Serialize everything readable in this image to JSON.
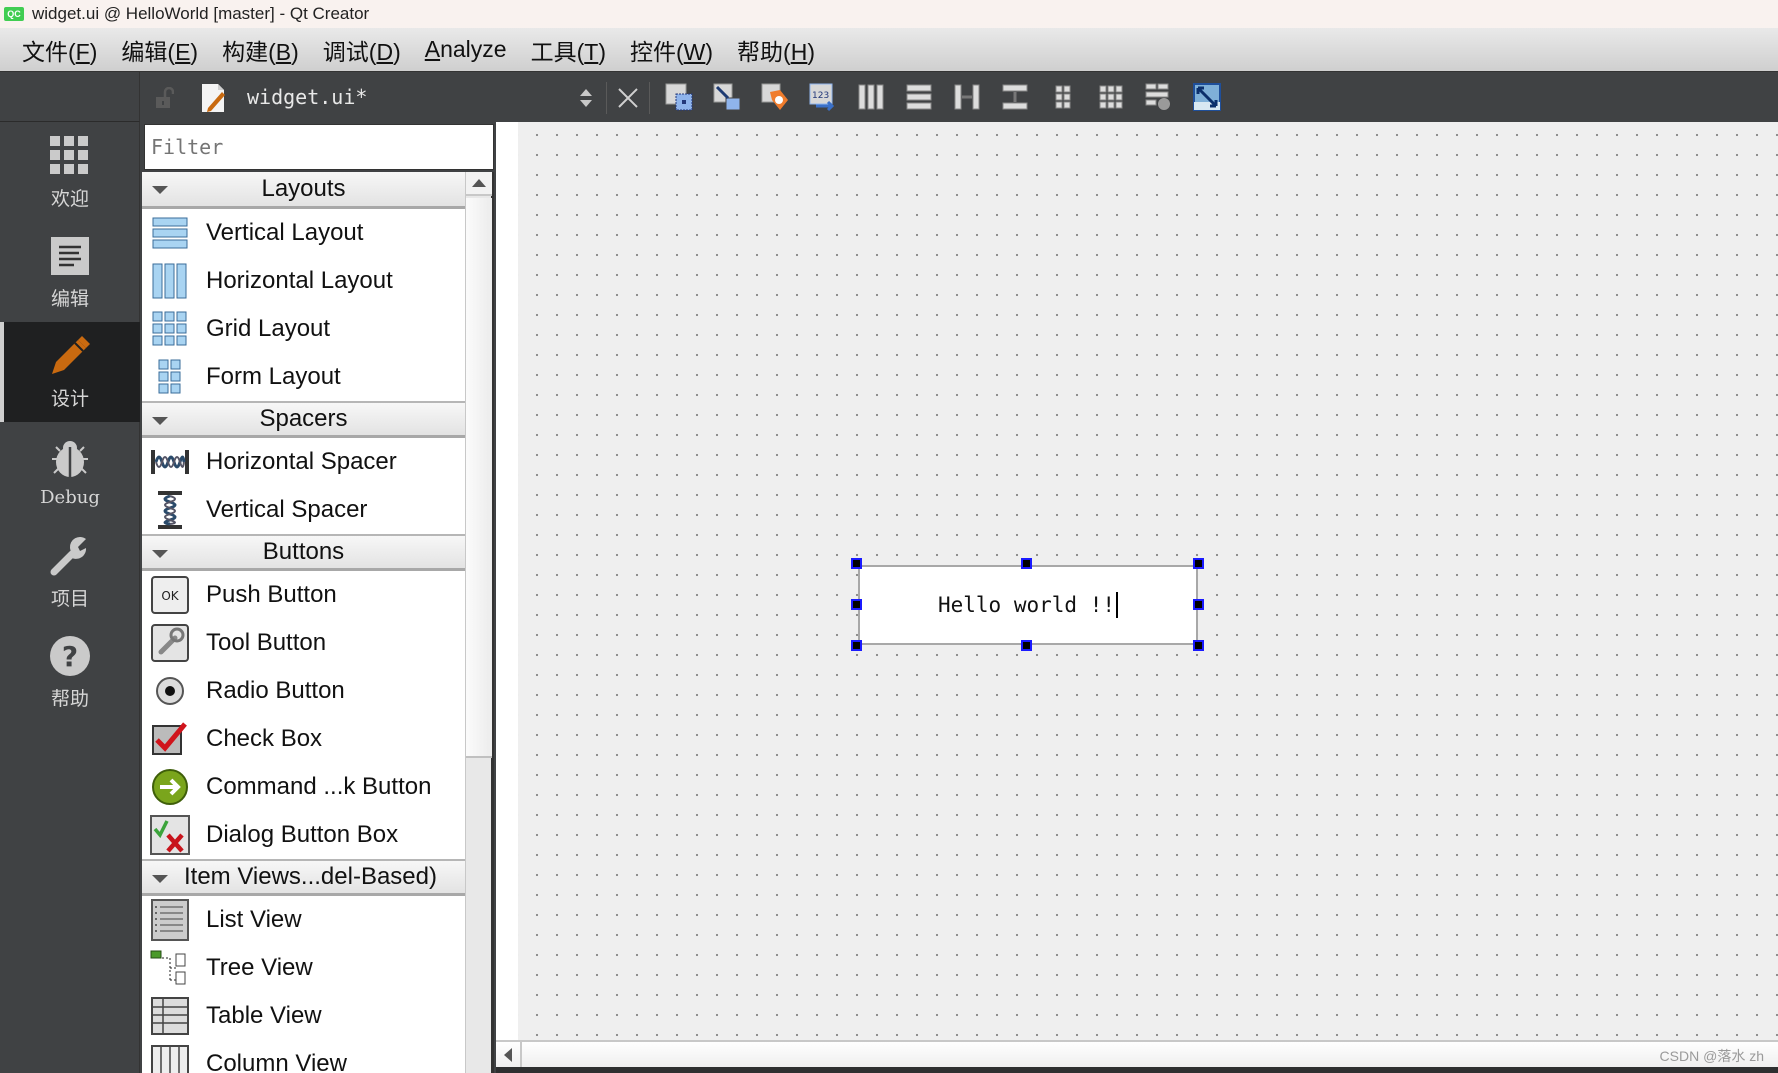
{
  "window": {
    "title": "widget.ui @ HelloWorld [master] - Qt Creator",
    "app_icon": "QC"
  },
  "menubar": {
    "items": [
      {
        "label": "文件(",
        "mnemonic": "F",
        "suffix": ")"
      },
      {
        "label": "编辑(",
        "mnemonic": "E",
        "suffix": ")"
      },
      {
        "label": "构建(",
        "mnemonic": "B",
        "suffix": ")"
      },
      {
        "label": "调试(",
        "mnemonic": "D",
        "suffix": ")"
      },
      {
        "label": "",
        "mnemonic": "A",
        "suffix": "nalyze"
      },
      {
        "label": "工具(",
        "mnemonic": "T",
        "suffix": ")"
      },
      {
        "label": "控件(",
        "mnemonic": "W",
        "suffix": ")"
      },
      {
        "label": "帮助(",
        "mnemonic": "H",
        "suffix": ")"
      }
    ]
  },
  "editor_toolbar": {
    "file_name": "widget.ui*",
    "tools": [
      {
        "name": "edit-widgets-icon"
      },
      {
        "name": "edit-signals-slots-icon"
      },
      {
        "name": "edit-buddies-icon"
      },
      {
        "name": "edit-tab-order-icon"
      },
      {
        "name": "lay-out-horizontally-icon"
      },
      {
        "name": "lay-out-vertically-icon"
      },
      {
        "name": "lay-out-horizontal-splitter-icon"
      },
      {
        "name": "lay-out-vertical-splitter-icon"
      },
      {
        "name": "lay-out-form-icon"
      },
      {
        "name": "lay-out-grid-icon"
      },
      {
        "name": "break-layout-icon"
      },
      {
        "name": "adjust-size-icon"
      }
    ]
  },
  "modes": [
    {
      "label": "欢迎",
      "icon": "welcome-grid-icon",
      "active": false
    },
    {
      "label": "编辑",
      "icon": "edit-document-icon",
      "active": false
    },
    {
      "label": "设计",
      "icon": "design-pencil-icon",
      "active": true
    },
    {
      "label": "Debug",
      "icon": "debug-bug-icon",
      "active": false
    },
    {
      "label": "项目",
      "icon": "projects-wrench-icon",
      "active": false
    },
    {
      "label": "帮助",
      "icon": "help-question-icon",
      "active": false
    }
  ],
  "widget_box": {
    "filter_placeholder": "Filter",
    "categories": [
      {
        "label": "Layouts",
        "items": [
          "Vertical Layout",
          "Horizontal Layout",
          "Grid Layout",
          "Form Layout"
        ]
      },
      {
        "label": "Spacers",
        "items": [
          "Horizontal Spacer",
          "Vertical Spacer"
        ]
      },
      {
        "label": "Buttons",
        "items": [
          "Push Button",
          "Tool Button",
          "Radio Button",
          "Check Box",
          "Command ...k Button",
          "Dialog Button Box"
        ]
      },
      {
        "label": "Item Views...del-Based)",
        "items": [
          "List View",
          "Tree View",
          "Table View",
          "Column View"
        ]
      }
    ]
  },
  "form": {
    "label_text": "Hello world !!"
  },
  "watermark": "CSDN @落水 zh"
}
